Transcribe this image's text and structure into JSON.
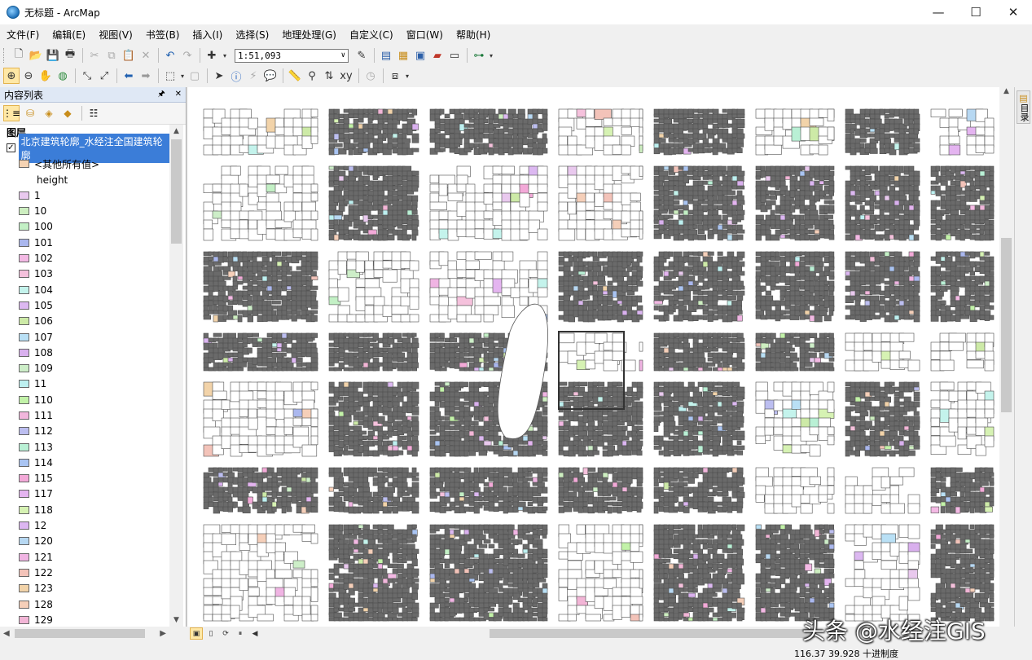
{
  "window": {
    "title": "无标题 - ArcMap",
    "min": "—",
    "max": "☐",
    "close": "✕"
  },
  "menu": [
    "文件(F)",
    "编辑(E)",
    "视图(V)",
    "书签(B)",
    "插入(I)",
    "选择(S)",
    "地理处理(G)",
    "自定义(C)",
    "窗口(W)",
    "帮助(H)"
  ],
  "toolbar": {
    "scale": "1:51,093",
    "scale_arrow": "∨"
  },
  "toc": {
    "title": "内容列表",
    "pin": "🖈",
    "close": "✕",
    "group": "图层",
    "layer": {
      "checked": "✓",
      "name": "北京建筑轮廓_水经注全国建筑轮廓"
    },
    "other_values": "<其他所有值>",
    "field": "height",
    "legend": [
      {
        "label": "1",
        "color": "#e9c9ee"
      },
      {
        "label": "10",
        "color": "#cdeec0"
      },
      {
        "label": "100",
        "color": "#c3f0c5"
      },
      {
        "label": "101",
        "color": "#aab7ee"
      },
      {
        "label": "102",
        "color": "#f3b9e4"
      },
      {
        "label": "103",
        "color": "#f5c1dc"
      },
      {
        "label": "104",
        "color": "#c4f3ec"
      },
      {
        "label": "105",
        "color": "#dcb8f1"
      },
      {
        "label": "106",
        "color": "#cdeaa7"
      },
      {
        "label": "107",
        "color": "#b9e0f5"
      },
      {
        "label": "108",
        "color": "#d9b0ee"
      },
      {
        "label": "109",
        "color": "#cdeec8"
      },
      {
        "label": "11",
        "color": "#bdf0f0"
      },
      {
        "label": "110",
        "color": "#c2f2a8"
      },
      {
        "label": "111",
        "color": "#f2b6dc"
      },
      {
        "label": "112",
        "color": "#bcbef0"
      },
      {
        "label": "113",
        "color": "#b9f0d5"
      },
      {
        "label": "114",
        "color": "#a9c4f2"
      },
      {
        "label": "115",
        "color": "#f3a9d8"
      },
      {
        "label": "117",
        "color": "#e4b4f0"
      },
      {
        "label": "118",
        "color": "#d6f2b3"
      },
      {
        "label": "12",
        "color": "#dcb6f2"
      },
      {
        "label": "120",
        "color": "#b7d8f2"
      },
      {
        "label": "121",
        "color": "#f0b4e3"
      },
      {
        "label": "122",
        "color": "#f3c3b9"
      },
      {
        "label": "123",
        "color": "#f2d3a9"
      },
      {
        "label": "128",
        "color": "#f5cfb9"
      },
      {
        "label": "129",
        "color": "#f2b5d6"
      }
    ]
  },
  "right_dock_tab": "目录",
  "status": {
    "coords": "116.37  39.928 十进制度"
  },
  "watermark": "头条 @水经注GIS"
}
